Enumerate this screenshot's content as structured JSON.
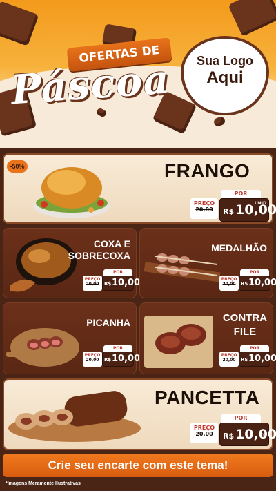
{
  "header": {
    "ribbon": "OFERTAS DE",
    "title": "Páscoa",
    "logo_line1": "Sua Logo",
    "logo_line2": "Aqui"
  },
  "discount_badge": "-50%",
  "products": [
    {
      "name": "FRANGO",
      "price_label": "PREÇO",
      "old_prefix": "R$",
      "old_price": "20,00",
      "por": "POR",
      "currency": "R$",
      "new_price": "10,00",
      "unit": "UNID"
    },
    {
      "name_line1": "COXA E",
      "name_line2": "SOBRECOXA",
      "price_label": "PREÇO",
      "old_prefix": "R$",
      "old_price": "20,00",
      "por": "POR",
      "currency": "R$",
      "new_price": "10,00"
    },
    {
      "name": "MEDALHÃO",
      "price_label": "PREÇO",
      "old_prefix": "R$",
      "old_price": "20,00",
      "por": "POR",
      "currency": "R$",
      "new_price": "10,00"
    },
    {
      "name": "PICANHA",
      "price_label": "PREÇO",
      "old_prefix": "R$",
      "old_price": "20,00",
      "por": "POR",
      "currency": "R$",
      "new_price": "10,00"
    },
    {
      "name_line1": "CONTRA",
      "name_line2": "FILE",
      "price_label": "PREÇO",
      "old_prefix": "R$",
      "old_price": "20,00",
      "por": "POR",
      "currency": "R$",
      "new_price": "10,00"
    },
    {
      "name": "PANCETTA",
      "price_label": "PREÇO",
      "old_prefix": "R$",
      "old_price": "20,00",
      "por": "POR",
      "currency": "R$",
      "new_price": "10,00",
      "unit": "KG"
    }
  ],
  "footer": {
    "cta": "Crie seu encarte com este tema!",
    "disclaimer": "*Imagens Meramente Ilustrativas"
  },
  "colors": {
    "orange": "#f07a1e",
    "brown": "#4a2214",
    "cream": "#f8ebd7"
  }
}
